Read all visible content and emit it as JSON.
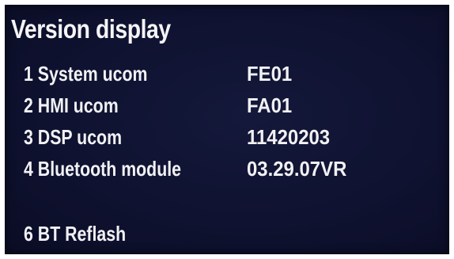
{
  "title": "Version display",
  "items": [
    {
      "number": "1",
      "label": "System ucom",
      "value": "FE01"
    },
    {
      "number": "2",
      "label": "HMI ucom",
      "value": "FA01"
    },
    {
      "number": "3",
      "label": "DSP ucom",
      "value": "11420203"
    },
    {
      "number": "4",
      "label": "Bluetooth module",
      "value": "03.29.07VR"
    }
  ],
  "actions": [
    {
      "number": "6",
      "label": "BT Reflash"
    }
  ],
  "colors": {
    "background": "#0f1230",
    "text": "#f1f1f4",
    "frame": "#ffffff"
  }
}
